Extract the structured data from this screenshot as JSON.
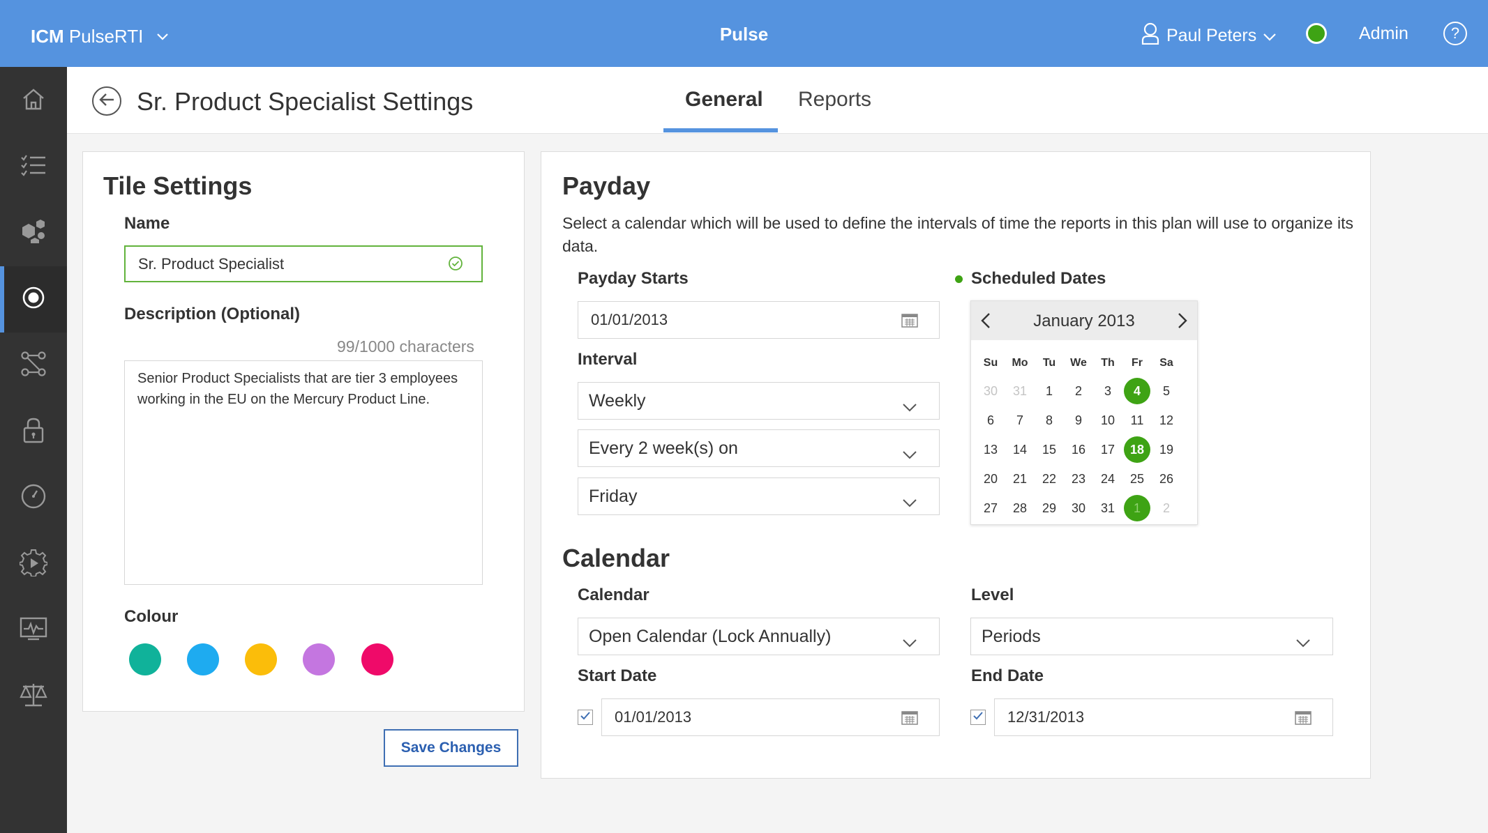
{
  "topbar": {
    "brand_bold": "ICM",
    "brand_rest": " PulseRTI",
    "app_title": "Pulse",
    "user_name": "Paul Peters",
    "role": "Admin",
    "help": "?",
    "colors": {
      "bar": "#5593df",
      "status": "#3ea314"
    }
  },
  "sidenav": {
    "items": [
      {
        "icon": "home-icon"
      },
      {
        "icon": "checklist-icon"
      },
      {
        "icon": "cubes-icon"
      },
      {
        "icon": "target-icon",
        "active": true
      },
      {
        "icon": "workflow-icon"
      },
      {
        "icon": "lock-icon"
      },
      {
        "icon": "clock-icon"
      },
      {
        "icon": "gear-play-icon"
      },
      {
        "icon": "pulse-monitor-icon"
      },
      {
        "icon": "scales-icon"
      }
    ]
  },
  "header": {
    "page_title": "Sr. Product Specialist Settings",
    "tabs": [
      {
        "label": "General",
        "active": true
      },
      {
        "label": "Reports",
        "active": false
      }
    ]
  },
  "tile_settings": {
    "title": "Tile Settings",
    "name_label": "Name",
    "name_value": "Sr. Product Specialist",
    "description_label": "Description (Optional)",
    "char_count": "99/1000 characters",
    "description_value": "Senior Product Specialists that are tier 3 employees working in the EU on the Mercury Product Line.",
    "colour_label": "Colour",
    "colours": [
      "#10b29a",
      "#1eabf0",
      "#fbbd0a",
      "#c476e0",
      "#ef0a69"
    ]
  },
  "save_label": "Save Changes",
  "payday": {
    "title": "Payday",
    "description": "Select a calendar which will be used to define the intervals of time the reports in this plan will use to organize its data.",
    "starts_label": "Payday Starts",
    "starts_value": "01/01/2013",
    "interval_label": "Interval",
    "interval_value": "Weekly",
    "frequency_value": "Every 2 week(s) on",
    "day_value": "Friday",
    "scheduled_label": "Scheduled Dates"
  },
  "datepicker": {
    "month_label": "January 2013",
    "days_of_week": [
      "Su",
      "Mo",
      "Tu",
      "We",
      "Th",
      "Fr",
      "Sa"
    ],
    "weeks": [
      [
        {
          "d": "30",
          "o": 1
        },
        {
          "d": "31",
          "o": 1
        },
        {
          "d": "1"
        },
        {
          "d": "2"
        },
        {
          "d": "3"
        },
        {
          "d": "4",
          "s": 1
        },
        {
          "d": "5"
        }
      ],
      [
        {
          "d": "6"
        },
        {
          "d": "7"
        },
        {
          "d": "8"
        },
        {
          "d": "9"
        },
        {
          "d": "10"
        },
        {
          "d": "11"
        },
        {
          "d": "12"
        }
      ],
      [
        {
          "d": "13"
        },
        {
          "d": "14"
        },
        {
          "d": "15"
        },
        {
          "d": "16"
        },
        {
          "d": "17"
        },
        {
          "d": "18",
          "s": 1
        },
        {
          "d": "19"
        }
      ],
      [
        {
          "d": "20"
        },
        {
          "d": "21"
        },
        {
          "d": "22"
        },
        {
          "d": "23"
        },
        {
          "d": "24"
        },
        {
          "d": "25"
        },
        {
          "d": "26"
        }
      ],
      [
        {
          "d": "27"
        },
        {
          "d": "28"
        },
        {
          "d": "29"
        },
        {
          "d": "30"
        },
        {
          "d": "31"
        },
        {
          "d": "1",
          "o": 1,
          "s": 1
        },
        {
          "d": "2",
          "o": 1
        }
      ]
    ]
  },
  "calendar": {
    "title": "Calendar",
    "calendar_label": "Calendar",
    "calendar_value": "Open Calendar (Lock Annually)",
    "level_label": "Level",
    "level_value": "Periods",
    "start_label": "Start Date",
    "start_value": "01/01/2013",
    "start_checked": true,
    "end_label": "End Date",
    "end_value": "12/31/2013",
    "end_checked": true
  }
}
